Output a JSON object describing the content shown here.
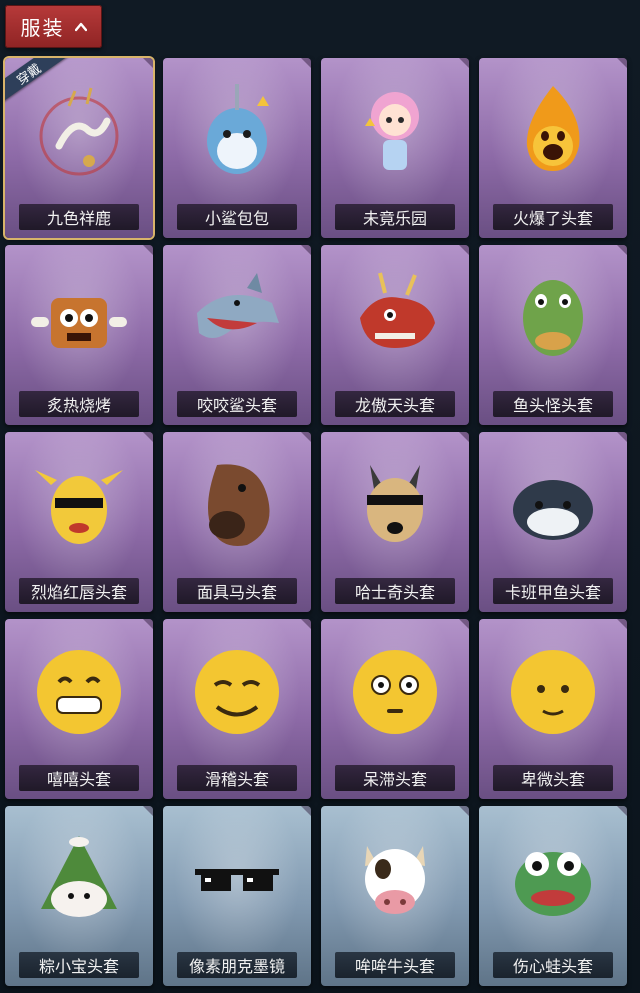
{
  "header": {
    "category_label": "服装"
  },
  "equipped_badge": "穿戴",
  "items": [
    {
      "name": "九色祥鹿",
      "icon": "deer-charm-icon",
      "tier": "purple",
      "equipped": true
    },
    {
      "name": "小鲨包包",
      "icon": "shark-bag-icon",
      "tier": "purple",
      "equipped": false
    },
    {
      "name": "未竟乐园",
      "icon": "doll-charm-icon",
      "tier": "purple",
      "equipped": false
    },
    {
      "name": "火爆了头套",
      "icon": "fire-head-icon",
      "tier": "purple",
      "equipped": false
    },
    {
      "name": "炙热烧烤",
      "icon": "grilled-meat-head-icon",
      "tier": "purple",
      "equipped": false
    },
    {
      "name": "咬咬鲨头套",
      "icon": "shark-head-icon",
      "tier": "purple",
      "equipped": false
    },
    {
      "name": "龙傲天头套",
      "icon": "dragon-head-icon",
      "tier": "purple",
      "equipped": false
    },
    {
      "name": "鱼头怪头套",
      "icon": "fish-head-icon",
      "tier": "purple",
      "equipped": false
    },
    {
      "name": "烈焰红唇头套",
      "icon": "yellow-mouse-head-icon",
      "tier": "purple",
      "equipped": false
    },
    {
      "name": "面具马头套",
      "icon": "horse-head-icon",
      "tier": "purple",
      "equipped": false
    },
    {
      "name": "哈士奇头套",
      "icon": "husky-head-icon",
      "tier": "purple",
      "equipped": false
    },
    {
      "name": "卡班甲鱼头套",
      "icon": "seal-head-icon",
      "tier": "purple",
      "equipped": false
    },
    {
      "name": "嘻嘻头套",
      "icon": "grin-emoji-head-icon",
      "tier": "purple",
      "equipped": false
    },
    {
      "name": "滑稽头套",
      "icon": "smirk-emoji-head-icon",
      "tier": "purple",
      "equipped": false
    },
    {
      "name": "呆滞头套",
      "icon": "dazed-emoji-head-icon",
      "tier": "purple",
      "equipped": false
    },
    {
      "name": "卑微头套",
      "icon": "humble-emoji-head-icon",
      "tier": "purple",
      "equipped": false
    },
    {
      "name": "粽小宝头套",
      "icon": "zongzi-head-icon",
      "tier": "blue",
      "equipped": false
    },
    {
      "name": "像素朋克墨镜",
      "icon": "pixel-sunglasses-icon",
      "tier": "blue",
      "equipped": false
    },
    {
      "name": "哞哞牛头套",
      "icon": "cow-head-icon",
      "tier": "blue",
      "equipped": false
    },
    {
      "name": "伤心蛙头套",
      "icon": "sad-frog-head-icon",
      "tier": "blue",
      "equipped": false
    }
  ]
}
